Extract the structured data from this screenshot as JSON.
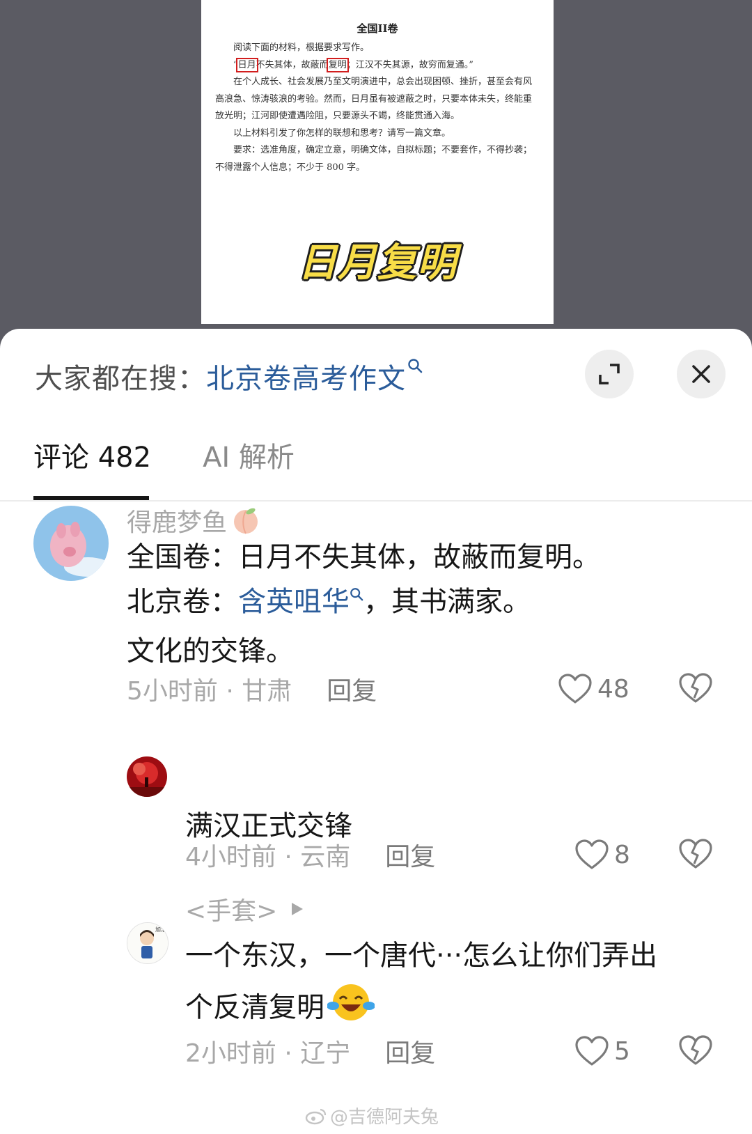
{
  "paper": {
    "title": "全国II卷",
    "line1": "阅读下面的材料，根据要求写作。",
    "quote_open": "“",
    "quote_hl1": "日月",
    "quote_mid": "不失其体，故蔽而",
    "quote_hl2": "复明",
    "quote_rest": "；江汉不失其源，故穷而复通。”",
    "para2": "在个人成长、社会发展乃至文明演进中，总会出现困顿、挫折，甚至会有风高浪急、惊涛骇浪的考验。然而，日月虽有被遮蔽之时，只要本体未失，终能重放光明；江河即使遭遇险阻，只要源头不竭，终能贯通入海。",
    "para3": "以上材料引发了你怎样的联想和思考？请写一篇文章。",
    "para4": "要求：选准角度，确定立意，明确文体，自拟标题；不要套作，不得抄袭；不得泄露个人信息；不少于 800 字。",
    "caption": "日月复明"
  },
  "search": {
    "prefix": "大家都在搜：",
    "query": "北京卷高考作文",
    "mag": "⚲"
  },
  "tabs": {
    "comments": "评论 482",
    "ai": "AI 解析"
  },
  "comments": [
    {
      "user": "得鹿梦鱼",
      "line1": "全国卷：日月不失其体，故蔽而复明。",
      "line2_prefix": "北京卷：",
      "line2_link": "含英咀华",
      "line2_suffix": "，其书满家。",
      "line3": "文化的交锋。",
      "time": "5小时前 · 甘肃",
      "reply": "回复",
      "likes": "48"
    },
    {
      "user": "",
      "text": "满汉正式交锋",
      "time": "4小时前 · 云南",
      "reply": "回复",
      "likes": "8"
    },
    {
      "user": "<手套>",
      "line1": "一个东汉，一个唐代···怎么让你们弄出",
      "line2": "个反清复明",
      "time": "2小时前 · 辽宁",
      "reply": "回复",
      "likes": "5"
    }
  ],
  "watermark": "@吉德阿夫兔",
  "colors": {
    "link": "#2b5c9a",
    "caption_yellow": "#f8dd47",
    "highlight_red": "#d21e1e"
  }
}
